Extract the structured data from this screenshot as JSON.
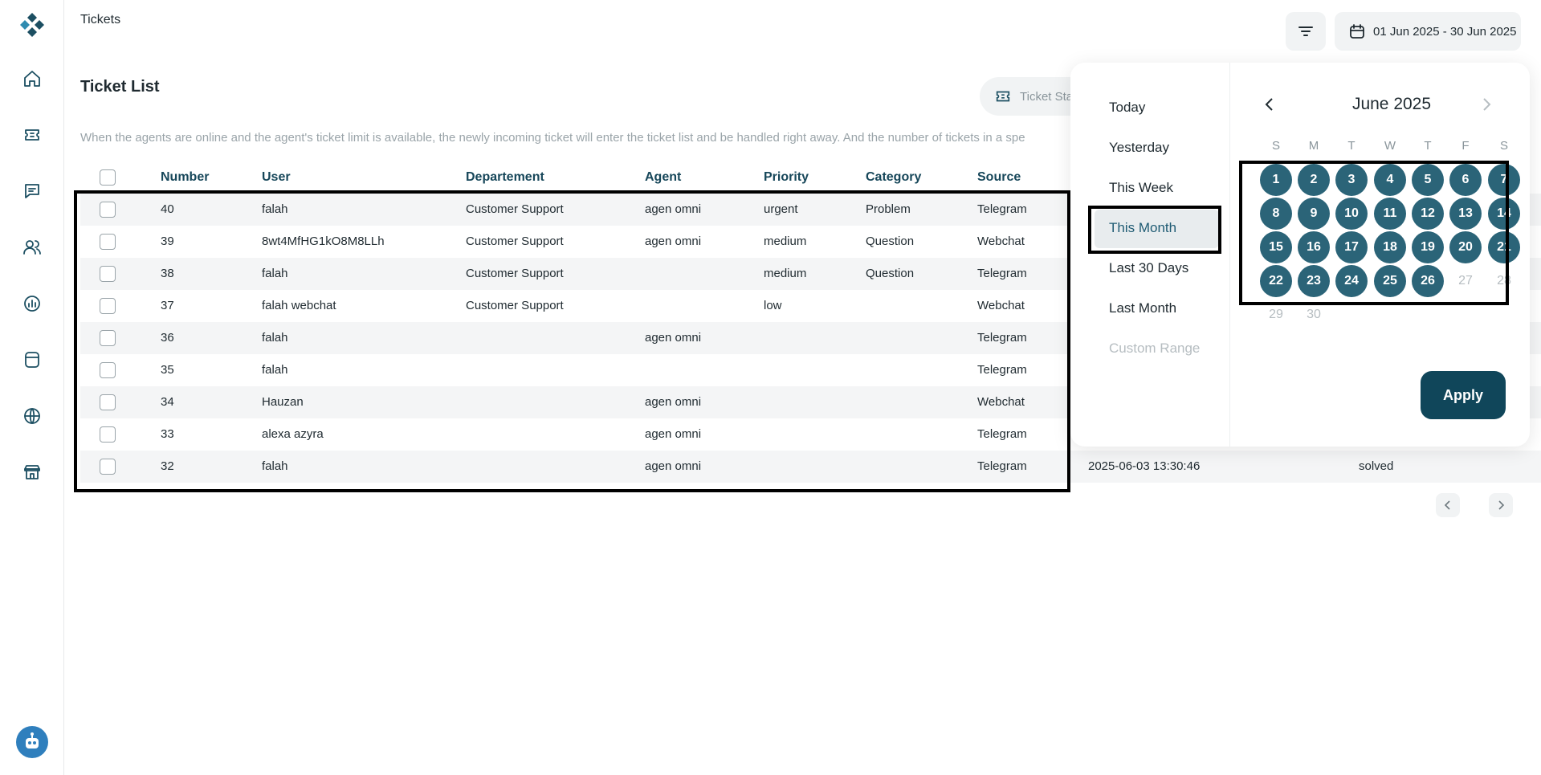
{
  "header": {
    "page_title": "Tickets",
    "date_range": "01 Jun 2025 - 30 Jun 2025"
  },
  "sidebar": {
    "items": [
      {
        "icon": "home-icon"
      },
      {
        "icon": "ticket-icon"
      },
      {
        "icon": "chat-icon"
      },
      {
        "icon": "users-icon"
      },
      {
        "icon": "report-icon"
      },
      {
        "icon": "database-icon"
      },
      {
        "icon": "globe-icon"
      },
      {
        "icon": "store-icon"
      }
    ]
  },
  "ticket_list": {
    "title": "Ticket List",
    "status_button": "Ticket Status",
    "info": "When the agents are online and the agent's ticket limit is available, the newly incoming ticket will enter the ticket list and be handled right away. And the number of tickets in a spe",
    "columns": [
      "Number",
      "User",
      "Departement",
      "Agent",
      "Priority",
      "Category",
      "Source"
    ],
    "rows": [
      {
        "number": "40",
        "user": "falah",
        "department": "Customer Support",
        "agent": "agen omni",
        "priority": "urgent",
        "category": "Problem",
        "source": "Telegram",
        "date": "",
        "status": ""
      },
      {
        "number": "39",
        "user": "8wt4MfHG1kO8M8LLh",
        "department": "Customer Support",
        "agent": "agen omni",
        "priority": "medium",
        "category": "Question",
        "source": "Webchat",
        "date": "",
        "status": ""
      },
      {
        "number": "38",
        "user": "falah",
        "department": "Customer Support",
        "agent": "",
        "priority": "medium",
        "category": "Question",
        "source": "Telegram",
        "date": "",
        "status": ""
      },
      {
        "number": "37",
        "user": "falah webchat",
        "department": "Customer Support",
        "agent": "",
        "priority": "low",
        "category": "",
        "source": "Webchat",
        "date": "",
        "status": ""
      },
      {
        "number": "36",
        "user": "falah",
        "department": "",
        "agent": "agen omni",
        "priority": "",
        "category": "",
        "source": "Telegram",
        "date": "",
        "status": ""
      },
      {
        "number": "35",
        "user": "falah",
        "department": "",
        "agent": "",
        "priority": "",
        "category": "",
        "source": "Telegram",
        "date": "",
        "status": ""
      },
      {
        "number": "34",
        "user": "Hauzan",
        "department": "",
        "agent": "agen omni",
        "priority": "",
        "category": "",
        "source": "Webchat",
        "date": "",
        "status": ""
      },
      {
        "number": "33",
        "user": "alexa azyra",
        "department": "",
        "agent": "agen omni",
        "priority": "",
        "category": "",
        "source": "Telegram",
        "date": "",
        "status": ""
      },
      {
        "number": "32",
        "user": "falah",
        "department": "",
        "agent": "agen omni",
        "priority": "",
        "category": "",
        "source": "Telegram",
        "date": "2025-06-03 13:30:46",
        "status": "solved"
      }
    ]
  },
  "date_picker": {
    "presets": [
      {
        "label": "Today",
        "state": "normal"
      },
      {
        "label": "Yesterday",
        "state": "normal"
      },
      {
        "label": "This Week",
        "state": "normal"
      },
      {
        "label": "This Month",
        "state": "active"
      },
      {
        "label": "Last 30 Days",
        "state": "normal"
      },
      {
        "label": "Last Month",
        "state": "normal"
      },
      {
        "label": "Custom Range",
        "state": "disabled"
      }
    ],
    "month_label": "June 2025",
    "weekdays": [
      "S",
      "M",
      "T",
      "W",
      "T",
      "F",
      "S"
    ],
    "days": [
      "1",
      "2",
      "3",
      "4",
      "5",
      "6",
      "7",
      "8",
      "9",
      "10",
      "11",
      "12",
      "13",
      "14",
      "15",
      "16",
      "17",
      "18",
      "19",
      "20",
      "21",
      "22",
      "23",
      "24",
      "25",
      "26",
      "27",
      "28",
      "29",
      "30"
    ],
    "selected_through": 26,
    "apply_label": "Apply"
  },
  "colors": {
    "accent": "#10465a",
    "selected_day": "#2b6478",
    "header_text": "#17475a"
  }
}
